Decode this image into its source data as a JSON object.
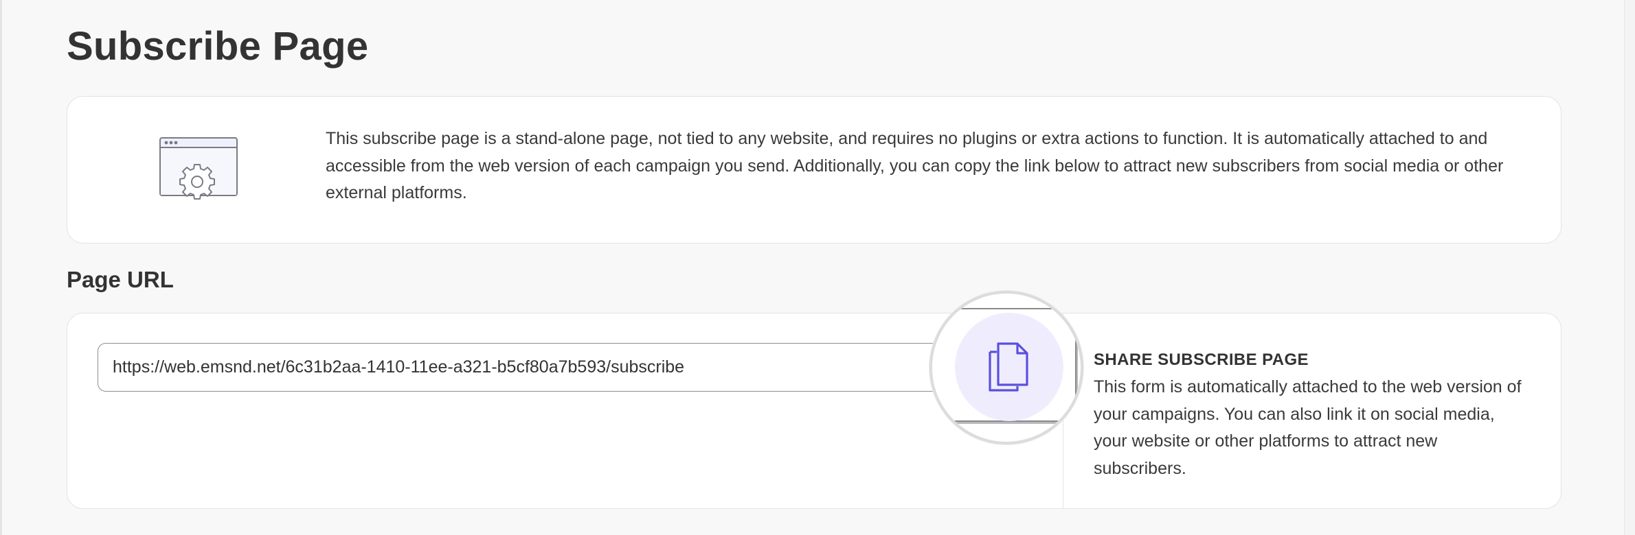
{
  "page": {
    "title": "Subscribe Page"
  },
  "info": {
    "illustration_icon": "browser-settings-icon",
    "text": "This subscribe page is a stand-alone page, not tied to any website, and requires no plugins or extra actions to function. It is automatically attached to and accessible from the web version of each campaign you send. Additionally, you can copy the link below to attract new subscribers from social media or other external platforms."
  },
  "page_url": {
    "heading": "Page URL",
    "url": "https://web.emsnd.net/6c31b2aa-1410-11ee-a321-b5cf80a7b593/subscribe",
    "copy_icon": "copy-icon",
    "copy_accent": "#5a50e0",
    "copy_bg": "#efedfd"
  },
  "share": {
    "title": "SHARE SUBSCRIBE PAGE",
    "text": "This form is automatically attached to the web version of your campaigns. You can also link it on social media, your website or other platforms to attract new subscribers."
  }
}
